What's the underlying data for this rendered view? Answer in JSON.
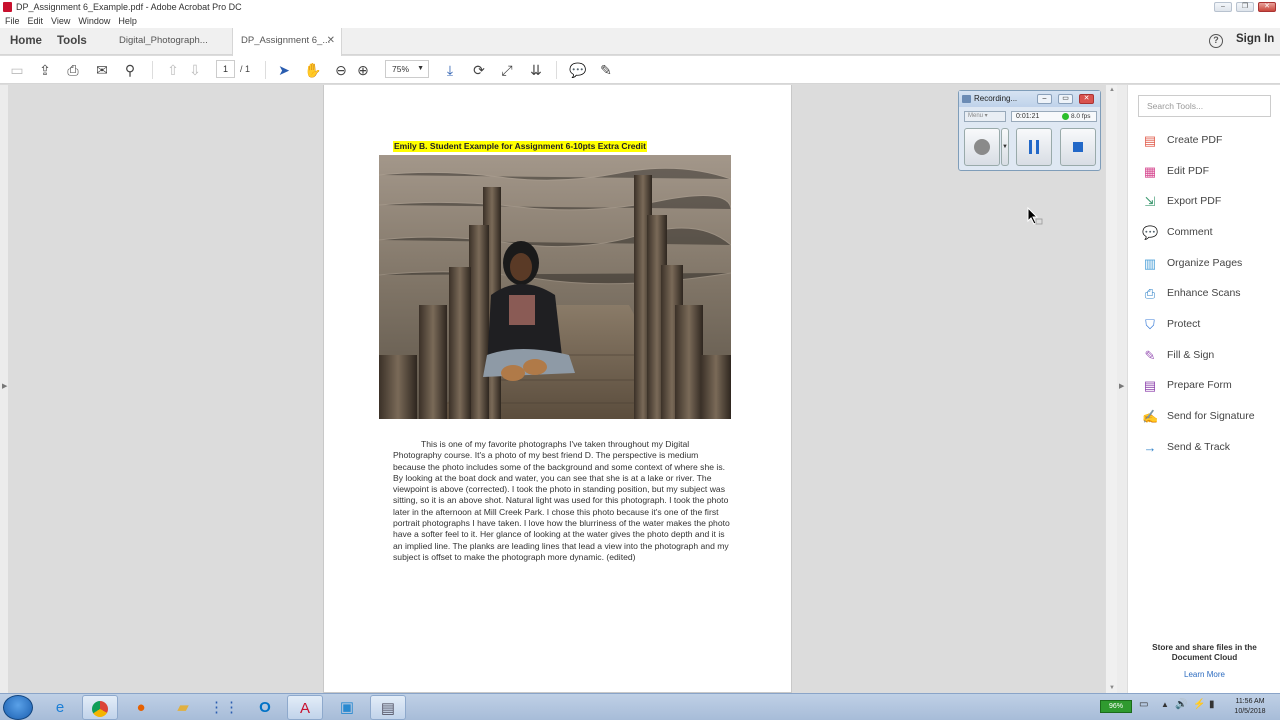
{
  "window": {
    "title": "DP_Assignment 6_Example.pdf - Adobe Acrobat Pro DC"
  },
  "menu": [
    "File",
    "Edit",
    "View",
    "Window",
    "Help"
  ],
  "tabs": {
    "home": "Home",
    "tools": "Tools",
    "doc1": "Digital_Photograph...",
    "doc2": "DP_Assignment 6_..."
  },
  "header": {
    "sign_in": "Sign In",
    "help_icon": "?"
  },
  "toolbar": {
    "page_current": "1",
    "page_total": "/ 1",
    "zoom": "75%"
  },
  "recorder": {
    "title": "Recording...",
    "menu": "Menu",
    "elapsed": "0:01:21",
    "fps": "8.0 fps"
  },
  "document": {
    "heading": "Emily B. Student Example for Assignment 6-10pts Extra Credit",
    "body": "This is one of my favorite photographs I've taken throughout my Digital Photography course.  It's a photo of my best friend D.  The perspective is medium because the photo includes some of the background and some context of where she is.  By looking at the boat dock and water, you can see that she is at a lake or river.  The viewpoint is above (corrected).  I took the photo in standing position, but my subject was sitting, so it is an above shot.  Natural light was used for this photograph.  I took the photo later in the afternoon at Mill Creek Park.  I chose this photo because it's one of the first portrait photographs I have taken.  I love how the blurriness of the water makes the photo have a softer feel to it.  Her glance of looking at the water gives the photo depth and it is an implied line. The planks are leading lines that lead a view into the photograph and my subject is offset to make the photograph more dynamic. (edited)"
  },
  "tools_pane": {
    "search_placeholder": "Search Tools...",
    "items": [
      {
        "label": "Create PDF",
        "icon": "create-pdf-icon",
        "color": "#e05a4a"
      },
      {
        "label": "Edit PDF",
        "icon": "edit-pdf-icon",
        "color": "#d6478f"
      },
      {
        "label": "Export PDF",
        "icon": "export-pdf-icon",
        "color": "#3d9970"
      },
      {
        "label": "Comment",
        "icon": "comment-icon",
        "color": "#f2c230"
      },
      {
        "label": "Organize Pages",
        "icon": "organize-pages-icon",
        "color": "#4a9fd8"
      },
      {
        "label": "Enhance Scans",
        "icon": "enhance-scans-icon",
        "color": "#2f82c8"
      },
      {
        "label": "Protect",
        "icon": "protect-icon",
        "color": "#3b7dd8"
      },
      {
        "label": "Fill & Sign",
        "icon": "fill-sign-icon",
        "color": "#9b59b6"
      },
      {
        "label": "Prepare Form",
        "icon": "prepare-form-icon",
        "color": "#8e44ad"
      },
      {
        "label": "Send for Signature",
        "icon": "send-signature-icon",
        "color": "#6c5ce7"
      },
      {
        "label": "Send & Track",
        "icon": "send-track-icon",
        "color": "#2f82c8"
      }
    ],
    "cloud_text": "Store and share files in the Document Cloud",
    "learn_more": "Learn More"
  },
  "taskbar": {
    "battery": "96%",
    "time": "11:56 AM",
    "date": "10/5/2018"
  }
}
